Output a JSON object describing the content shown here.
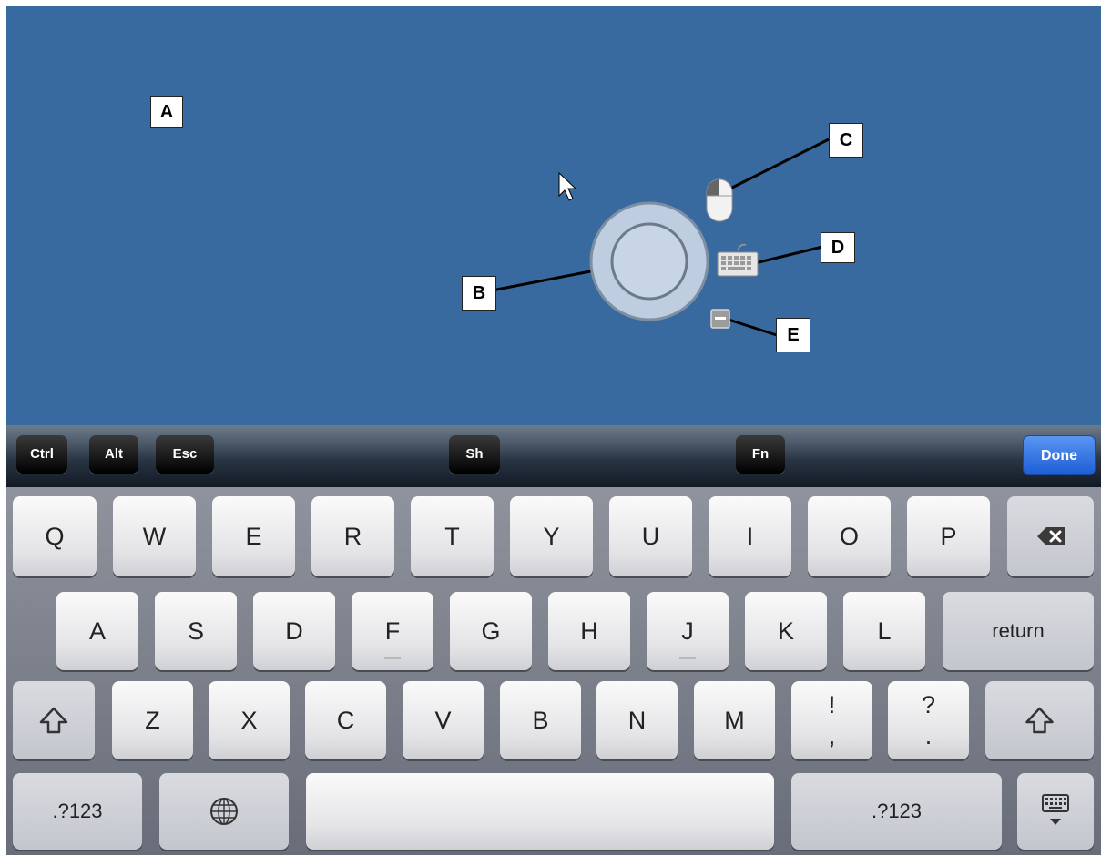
{
  "desktop": {
    "background": "#386a9f",
    "callouts": {
      "a": "A",
      "b": "B",
      "c": "C",
      "d": "D",
      "e": "E"
    }
  },
  "toolbar": {
    "ctrl": "Ctrl",
    "alt": "Alt",
    "esc": "Esc",
    "shift": "Sh",
    "fn": "Fn",
    "done": "Done"
  },
  "keyboard": {
    "row1": [
      "Q",
      "W",
      "E",
      "R",
      "T",
      "Y",
      "U",
      "I",
      "O",
      "P"
    ],
    "row2": [
      "A",
      "S",
      "D",
      "F",
      "G",
      "H",
      "J",
      "K",
      "L"
    ],
    "return": "return",
    "row3": [
      "Z",
      "X",
      "C",
      "V",
      "B",
      "N",
      "M"
    ],
    "excl_top": "!",
    "excl_bottom": ",",
    "quest_top": "?",
    "quest_bottom": ".",
    "numbers_left": ".?123",
    "numbers_right": ".?123"
  }
}
